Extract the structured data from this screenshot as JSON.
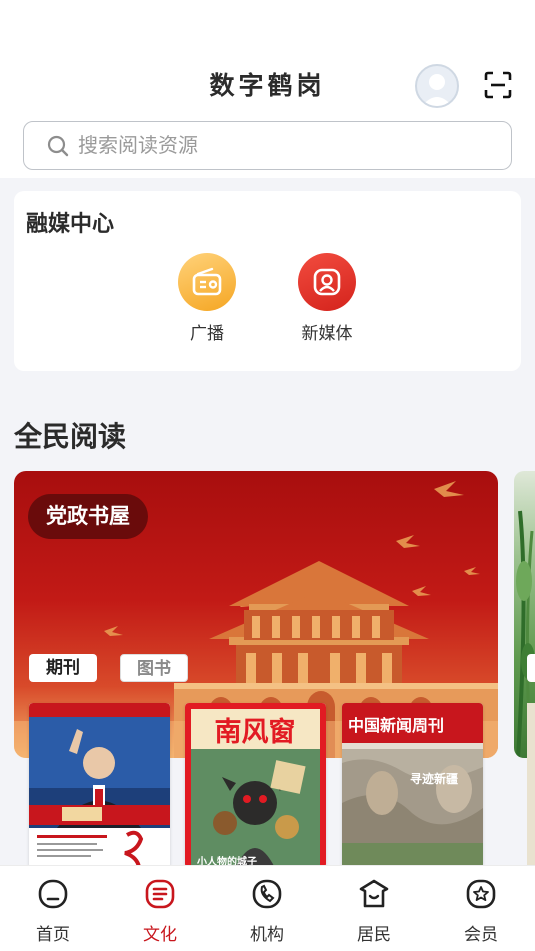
{
  "header": {
    "app_title": "数字鹤岗",
    "search_placeholder": "搜索阅读资源"
  },
  "media_center": {
    "title": "融媒中心",
    "items": [
      {
        "label": "广播",
        "icon": "radio-icon"
      },
      {
        "label": "新媒体",
        "icon": "new-media-icon"
      }
    ]
  },
  "reading": {
    "title": "全民阅读",
    "banner_label": "党政书屋",
    "tabs": [
      {
        "label": "期刊",
        "active": true
      },
      {
        "label": "图书",
        "active": false
      }
    ],
    "books": [
      {
        "title": "Qiushi magazine cover",
        "cover_text": "求是",
        "name_line": "习近平"
      },
      {
        "title": "南风窗",
        "cover_sub": "小人物的城子"
      },
      {
        "title": "中国新闻周刊",
        "cover_sub": "寻迹新疆"
      }
    ]
  },
  "bottom_nav": [
    {
      "label": "首页",
      "icon": "home-icon",
      "active": false
    },
    {
      "label": "文化",
      "icon": "culture-icon",
      "active": true
    },
    {
      "label": "机构",
      "icon": "institution-icon",
      "active": false
    },
    {
      "label": "居民",
      "icon": "residents-icon",
      "active": false
    },
    {
      "label": "会员",
      "icon": "member-icon",
      "active": false
    }
  ],
  "colors": {
    "accent": "#c8161d",
    "radio": "#f5a623",
    "new_media": "#d4231c"
  }
}
